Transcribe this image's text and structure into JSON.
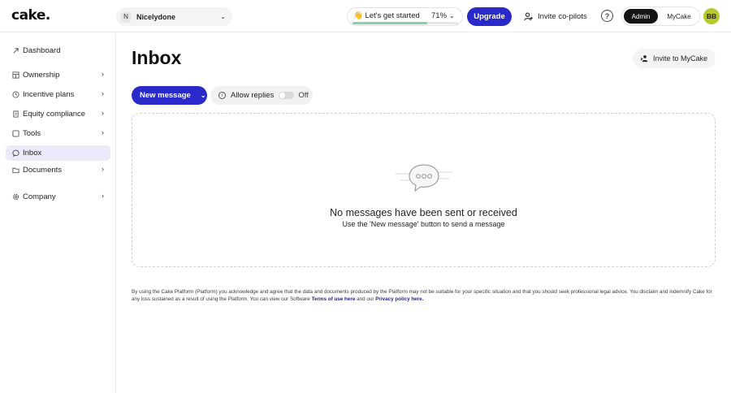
{
  "app": {
    "logo": "cake."
  },
  "header": {
    "company_initial": "N",
    "company_name": "Nicelydone",
    "progress_text": "👋 Let's get started",
    "progress_pct_label": "71%",
    "progress_value": 0.71,
    "upgrade_label": "Upgrade",
    "invite_copilots_label": "Invite co-pilots",
    "help_glyph": "?",
    "role_admin": "Admin",
    "role_mycake": "MyCake",
    "avatar_initials": "BB"
  },
  "sidebar": {
    "items": [
      {
        "label": "Dashboard",
        "icon": "rocket-icon",
        "chevron": false,
        "active": false
      },
      {
        "label": "Ownership",
        "icon": "table-icon",
        "chevron": true,
        "active": false
      },
      {
        "label": "Incentive plans",
        "icon": "clock-icon",
        "chevron": true,
        "active": false
      },
      {
        "label": "Equity compliance",
        "icon": "document-icon",
        "chevron": true,
        "active": false
      },
      {
        "label": "Tools",
        "icon": "wrench-icon",
        "chevron": true,
        "active": false
      },
      {
        "label": "Inbox",
        "icon": "chat-icon",
        "chevron": false,
        "active": true
      },
      {
        "label": "Documents",
        "icon": "folder-icon",
        "chevron": true,
        "active": false
      },
      {
        "label": "Company",
        "icon": "gear-icon",
        "chevron": true,
        "active": false
      }
    ]
  },
  "main": {
    "title": "Inbox",
    "invite_mycake_label": "Invite to MyCake",
    "new_message_label": "New message",
    "allow_replies_label": "Allow replies",
    "allow_replies_state": "Off",
    "empty_title": "No messages have been sent or received",
    "empty_subtitle": "Use the 'New message' button to send a message"
  },
  "legal": {
    "text": "By using the Cake Platform (Platform) you acknowledge and agree that the data and documents produced by the Platform may not be suitable for your specific situation and that you should seek professional legal advice. You disclaim and indemnify Cake for any loss sustained as a result of using the Platform. You can view our Software",
    "terms_link": "Terms of use here",
    "and_our": "and our",
    "privacy_link": "Privacy policy here."
  },
  "colors": {
    "accent": "#2a29c9",
    "progress": "#7ed6a7",
    "avatar": "#b9c82e",
    "active_nav": "#eaeafb"
  }
}
